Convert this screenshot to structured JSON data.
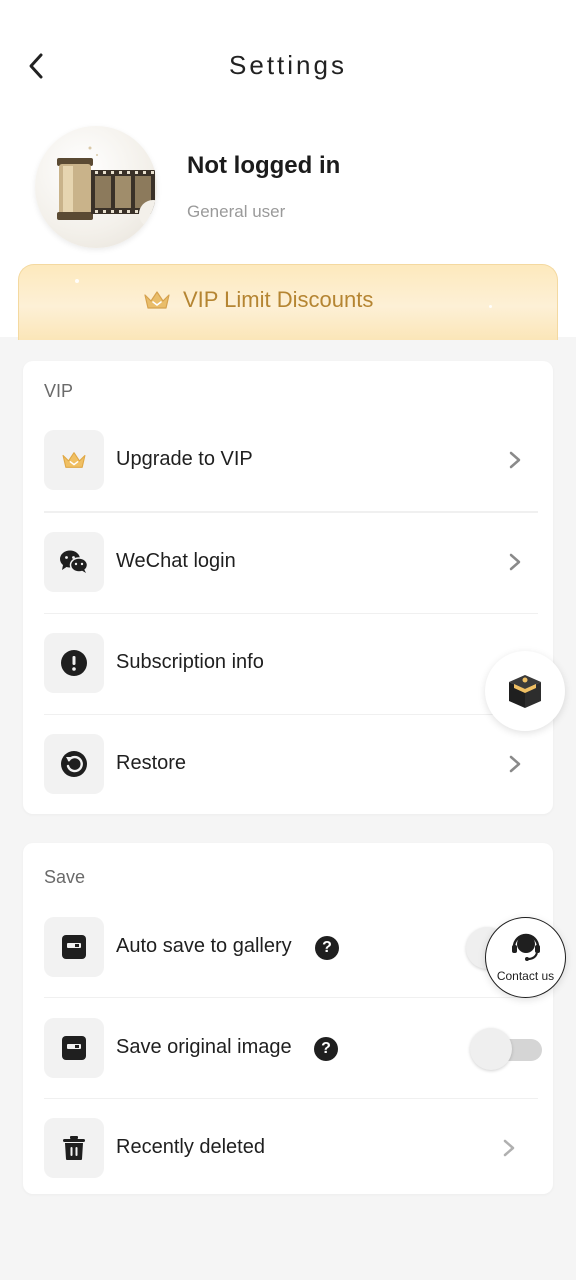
{
  "header": {
    "title": "Settings",
    "back_icon": "chevron-left-icon"
  },
  "profile": {
    "name": "Not logged in",
    "type": "General user",
    "avatar_icon": "film-roll-icon"
  },
  "vip_banner": {
    "label": "VIP Limit Discounts",
    "icon": "crown-icon",
    "color": "#b58532"
  },
  "vip_section": {
    "title": "VIP",
    "items": [
      {
        "label": "Upgrade to VIP",
        "icon": "crown-icon"
      },
      {
        "label": "WeChat login",
        "icon": "wechat-icon"
      },
      {
        "label": "Subscription info",
        "icon": "exclamation-icon"
      },
      {
        "label": "Restore",
        "icon": "restore-icon"
      }
    ]
  },
  "save_section": {
    "title": "Save",
    "items": [
      {
        "label": "Auto save to gallery",
        "icon": "save-icon",
        "help": "?",
        "toggle_on": false
      },
      {
        "label": "Save original image",
        "icon": "save-icon",
        "help": "?",
        "toggle_on": false
      },
      {
        "label": "Recently deleted",
        "icon": "trash-icon"
      }
    ]
  },
  "floating": {
    "box_icon": "gift-box-icon",
    "contact_label": "Contact us",
    "contact_icon": "headset-icon"
  }
}
